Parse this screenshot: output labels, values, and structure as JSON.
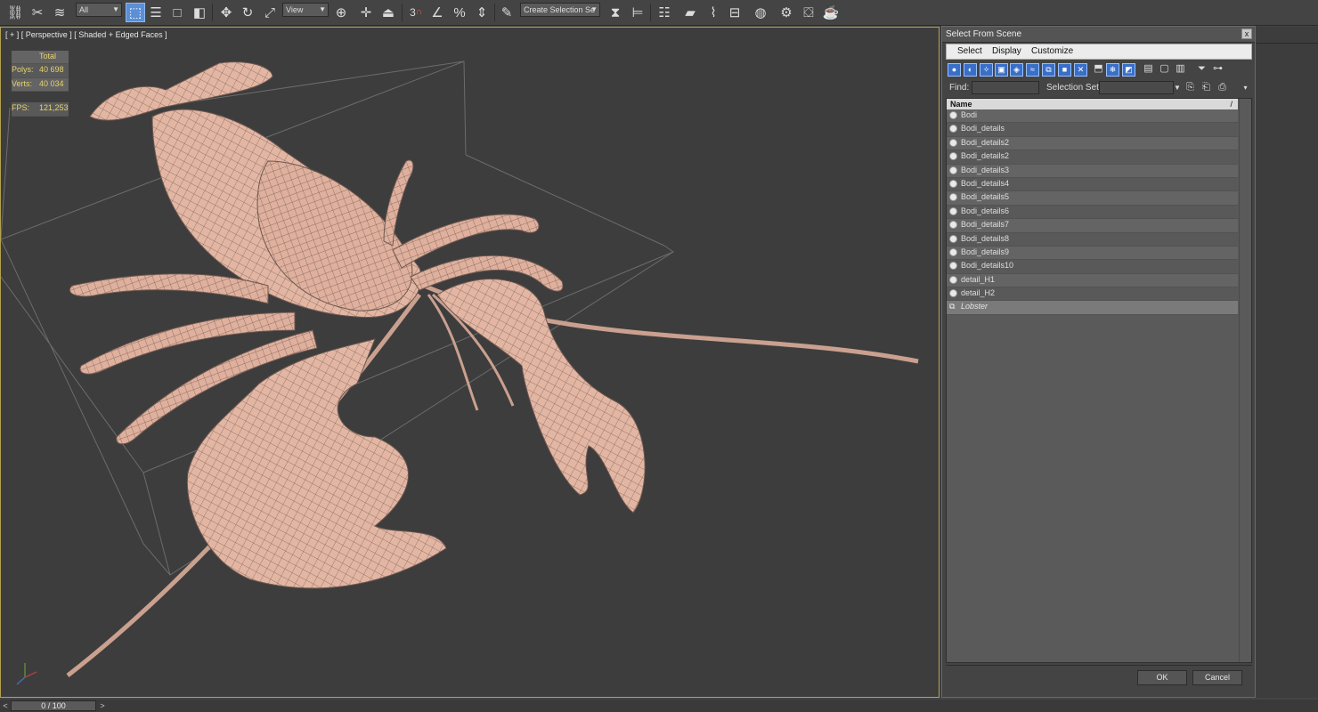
{
  "toolbar": {
    "selection_filter": "All",
    "ref_coord": "View",
    "snap_label": "3",
    "named_selection_placeholder": "Create Selection Se"
  },
  "viewport": {
    "label": "[ + ] [ Perspective ] [ Shaded + Edged Faces ]",
    "stats": {
      "total_label": "Total",
      "polys_label": "Polys:",
      "polys_value": "40 698",
      "verts_label": "Verts:",
      "verts_value": "40 034",
      "fps_label": "FPS:",
      "fps_value": "121,253"
    },
    "colors": {
      "border": "#b5a14f",
      "stats": "#e6d36a",
      "mesh": "#e3b6a3",
      "wire": "#6f5a52",
      "bbox": "#6a6a6a"
    }
  },
  "timeline": {
    "frame_label": "0 / 100",
    "prev": "<",
    "next": ">"
  },
  "dialog": {
    "title": "Select From Scene",
    "close": "x",
    "menu": [
      "Select",
      "Display",
      "Customize"
    ],
    "find_label": "Find:",
    "find_value": "",
    "selection_set_label": "Selection Set:",
    "selection_set_value": "",
    "column_name": "Name",
    "sort_indicator": "/",
    "items": [
      "Bodi",
      "Bodi_details",
      "Bodi_details2",
      "Bodi_details2",
      "Bodi_details3",
      "Bodi_details4",
      "Bodi_details5",
      "Bodi_details6",
      "Bodi_details7",
      "Bodi_details8",
      "Bodi_details9",
      "Bodi_details10",
      "detail_H1",
      "detail_H2",
      "Lobster"
    ],
    "ok_label": "OK",
    "cancel_label": "Cancel"
  }
}
